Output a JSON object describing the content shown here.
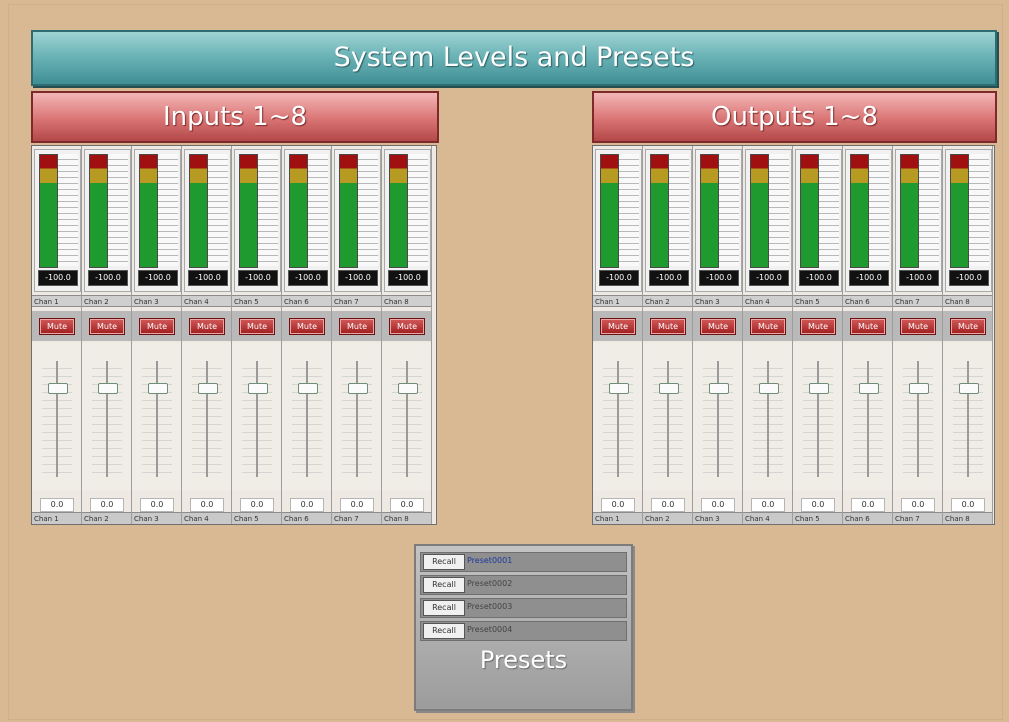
{
  "title": "System Levels and Presets",
  "sections": {
    "inputs": {
      "label": "Inputs 1~8",
      "channels": [
        {
          "top": "Chan 1",
          "bottom": "Chan 1",
          "level": "-100.0",
          "mute": "Mute",
          "gain": "0.0",
          "fader": 0.78
        },
        {
          "top": "Chan 2",
          "bottom": "Chan 2",
          "level": "-100.0",
          "mute": "Mute",
          "gain": "0.0",
          "fader": 0.78
        },
        {
          "top": "Chan 3",
          "bottom": "Chan 3",
          "level": "-100.0",
          "mute": "Mute",
          "gain": "0.0",
          "fader": 0.78
        },
        {
          "top": "Chan 4",
          "bottom": "Chan 4",
          "level": "-100.0",
          "mute": "Mute",
          "gain": "0.0",
          "fader": 0.78
        },
        {
          "top": "Chan 5",
          "bottom": "Chan 5",
          "level": "-100.0",
          "mute": "Mute",
          "gain": "0.0",
          "fader": 0.78
        },
        {
          "top": "Chan 6",
          "bottom": "Chan 6",
          "level": "-100.0",
          "mute": "Mute",
          "gain": "0.0",
          "fader": 0.78
        },
        {
          "top": "Chan 7",
          "bottom": "Chan 7",
          "level": "-100.0",
          "mute": "Mute",
          "gain": "0.0",
          "fader": 0.78
        },
        {
          "top": "Chan 8",
          "bottom": "Chan 8",
          "level": "-100.0",
          "mute": "Mute",
          "gain": "0.0",
          "fader": 0.78
        }
      ]
    },
    "outputs": {
      "label": "Outputs 1~8",
      "channels": [
        {
          "top": "Chan 1",
          "bottom": "Chan 1",
          "level": "-100.0",
          "mute": "Mute",
          "gain": "0.0",
          "fader": 0.78
        },
        {
          "top": "Chan 2",
          "bottom": "Chan 2",
          "level": "-100.0",
          "mute": "Mute",
          "gain": "0.0",
          "fader": 0.78
        },
        {
          "top": "Chan 3",
          "bottom": "Chan 3",
          "level": "-100.0",
          "mute": "Mute",
          "gain": "0.0",
          "fader": 0.78
        },
        {
          "top": "Chan 4",
          "bottom": "Chan 4",
          "level": "-100.0",
          "mute": "Mute",
          "gain": "0.0",
          "fader": 0.78
        },
        {
          "top": "Chan 5",
          "bottom": "Chan 5",
          "level": "-100.0",
          "mute": "Mute",
          "gain": "0.0",
          "fader": 0.78
        },
        {
          "top": "Chan 6",
          "bottom": "Chan 6",
          "level": "-100.0",
          "mute": "Mute",
          "gain": "0.0",
          "fader": 0.78
        },
        {
          "top": "Chan 7",
          "bottom": "Chan 7",
          "level": "-100.0",
          "mute": "Mute",
          "gain": "0.0",
          "fader": 0.78
        },
        {
          "top": "Chan 8",
          "bottom": "Chan 8",
          "level": "-100.0",
          "mute": "Mute",
          "gain": "0.0",
          "fader": 0.78
        }
      ]
    }
  },
  "presets": {
    "label": "Presets",
    "items": [
      {
        "button": "Recall",
        "name": "Preset0001"
      },
      {
        "button": "Recall",
        "name": "Preset0002"
      },
      {
        "button": "Recall",
        "name": "Preset0003"
      },
      {
        "button": "Recall",
        "name": "Preset0004"
      }
    ]
  },
  "colors": {
    "background": "#d8b994",
    "title_bar": "#6cb4b7",
    "section_header": "#d97474",
    "mute": "#9f1e1e",
    "meter_green": "#1e9a2e",
    "meter_yellow": "#b79a22",
    "meter_red": "#a01010"
  }
}
